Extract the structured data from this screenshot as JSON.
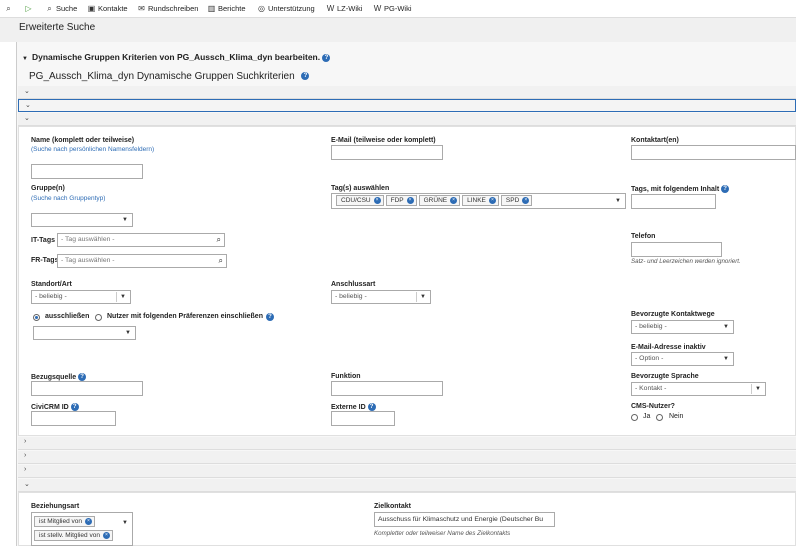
{
  "menu": {
    "items": [
      {
        "icon": "search-icon",
        "glyph": "⌕",
        "label": ""
      },
      {
        "icon": "civicrm-logo-icon",
        "glyph": "▷",
        "label": ""
      },
      {
        "icon": "search-icon",
        "glyph": "⌕",
        "label": "Suche"
      },
      {
        "icon": "contacts-icon",
        "glyph": "▣",
        "label": "Kontakte"
      },
      {
        "icon": "mail-icon",
        "glyph": "✉",
        "label": "Rundschreiben"
      },
      {
        "icon": "reports-icon",
        "glyph": "▥",
        "label": "Berichte"
      },
      {
        "icon": "support-icon",
        "glyph": "◎",
        "label": "Unterstützung"
      },
      {
        "icon": "wiki-icon",
        "glyph": "W",
        "label": "LZ-Wiki"
      },
      {
        "icon": "wiki-icon",
        "glyph": "W",
        "label": "PG-Wiki"
      }
    ]
  },
  "page": {
    "title": "Erweiterte Suche",
    "accordion_title": "Dynamische Gruppen Kriterien von PG_Aussch_Klima_dyn bearbeiten.",
    "subtitle": "PG_Aussch_Klima_dyn Dynamische Gruppen Suchkriterien"
  },
  "form": {
    "name_label": "Name (komplett oder teilweise)",
    "name_sub": "(Suche nach persönlichen Namensfeldern)",
    "name_value": "",
    "email_label": "E-Mail (teilweise oder komplett)",
    "email_value": "",
    "contact_type_label": "Kontaktart(en)",
    "group_label": "Gruppe(n)",
    "group_sub": "(Suche nach Gruppentyp)",
    "tags_select_label": "Tag(s) auswählen",
    "tags": [
      "CDU/CSU",
      "FDP",
      "GRÜNE",
      "LINKE",
      "SPD"
    ],
    "tags_content_label": "Tags, mit folgendem Inhalt",
    "it_tags_label": "IT-Tags",
    "it_tags_placeholder": "- Tag auswählen -",
    "fr_tags_label": "FR-Tags",
    "fr_tags_placeholder": "- Tag auswählen -",
    "phone_label": "Telefon",
    "phone_note": "Satz- und Leerzeichen werden ignoriert.",
    "location_label": "Standort/Art",
    "location_value": "- beliebig -",
    "connection_label": "Anschlussart",
    "connection_value": "- beliebig -",
    "exclude_label": "ausschließen",
    "include_label": "Nutzer mit folgenden Präferenzen einschließen",
    "pref_contact_label": "Bevorzugte Kontaktwege",
    "pref_contact_value": "- beliebig -",
    "email_inactive_label": "E-Mail-Adresse inaktiv",
    "email_inactive_value": "- Option -",
    "source_label": "Bezugsquelle",
    "function_label": "Funktion",
    "pref_language_label": "Bevorzugte Sprache",
    "pref_language_value": "- Kontakt -",
    "civicrm_id_label": "CiviCRM ID",
    "external_id_label": "Externe ID",
    "cms_user_label": "CMS-Nutzer?",
    "yes_label": "Ja",
    "no_label": "Nein"
  },
  "relationship": {
    "type_label": "Beziehungsart",
    "type_tags": [
      "ist Mitglied von",
      "ist stellv. Mitglied von"
    ],
    "target_label": "Zielkontakt",
    "target_value": "Ausschuss für Klimaschutz und Energie (Deutscher Bu",
    "target_note": "Kompletter oder teilweiser Name des Zielkontakts"
  },
  "colors": {
    "accent": "#2d6cb5",
    "header_bg": "#f0f0f0"
  }
}
